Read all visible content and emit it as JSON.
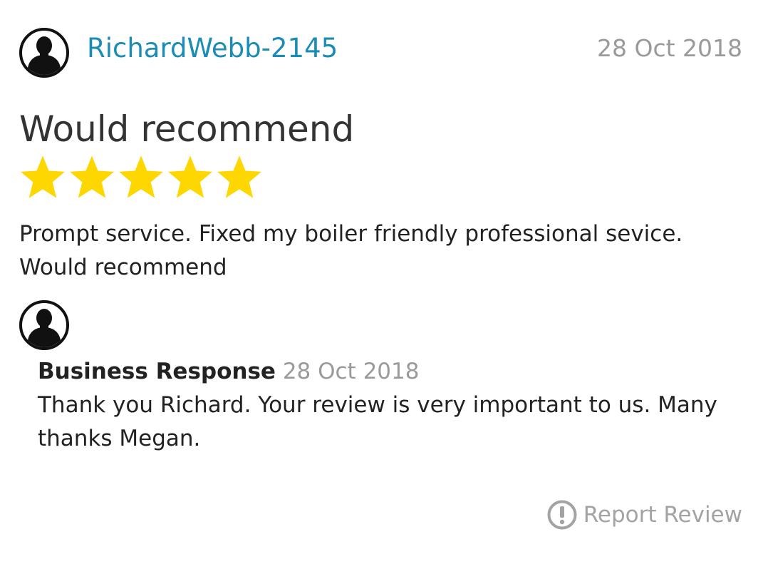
{
  "review": {
    "reviewer_name": "RichardWebb-2145",
    "date": "28 Oct 2018",
    "title": "Would recommend",
    "rating": 5,
    "rating_max": 5,
    "body": "Prompt service. Fixed my boiler friendly professional sevice. Would recommend"
  },
  "response": {
    "label": "Business Response",
    "date": "28 Oct 2018",
    "body": "Thank you Richard. Your review is very important to us. Many thanks Megan."
  },
  "actions": {
    "report_label": "Report Review",
    "report_icon": "exclamation-circle-icon"
  },
  "colors": {
    "name_link": "#1b8cb6",
    "star": "#ffd700",
    "muted": "#9a9a9a"
  }
}
